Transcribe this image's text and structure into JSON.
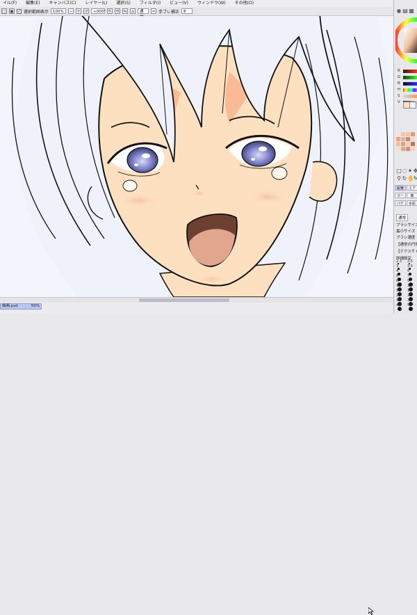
{
  "menubar": {
    "items": [
      "イル(F)",
      "編集(E)",
      "キャンバス(C)",
      "レイヤー(L)",
      "選択(S)",
      "フィルタ(I)",
      "ビュー(V)",
      "ウィンドウ(W)",
      "その他(O)"
    ]
  },
  "toolbar": {
    "selection_checkbox_checked": true,
    "selection_label": "選択範囲表示",
    "zoom_value": "100%",
    "rotation_value": "+000°",
    "blend_mode": "通常",
    "stabilizer_label": "手ブレ補正",
    "stabilizer_value": "8"
  },
  "document": {
    "tab_name": "描画.psd",
    "tab_zoom": "50%"
  },
  "right_panel": {
    "slider_letters": [
      "R",
      "G",
      "B",
      "H",
      "S",
      "V"
    ],
    "tool_tabs": [
      "鉛筆",
      "エアブラシ",
      "マーカー",
      "筆",
      "バケツ",
      "水彩筆"
    ],
    "blend_mode_label": "通常",
    "brush_size_label": "ブラシサイズ",
    "min_size_label": "最小サイズ",
    "brush_density_label": "ブラシ濃度",
    "normal_circle_label": "【通常の円形】",
    "no_texture_label": "【テクスチャなし】",
    "detail_settings_label": "詳細設定",
    "brush_sizes": [
      "2.3",
      "2.5",
      "3",
      "3.5",
      "4",
      "5",
      "6",
      "7",
      "8",
      "9",
      "10",
      "12",
      "14",
      "16",
      "20",
      "25",
      "30",
      "35",
      "40",
      "50"
    ]
  },
  "colors": {
    "skin": "#fde0c0",
    "hair": "#eff1fb",
    "iris": "#8b8fd3",
    "mouth": "#6e4032",
    "tongue": "#e2a68f",
    "accent": "#b9c6ee"
  }
}
